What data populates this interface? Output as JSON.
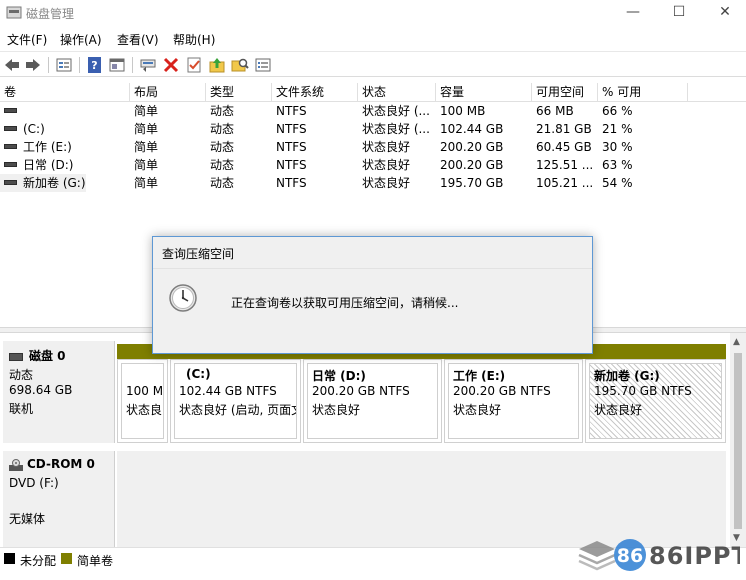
{
  "window": {
    "title": "磁盘管理",
    "controls": {
      "minimize": "—",
      "maximize": "☐",
      "close": "✕"
    }
  },
  "menu": [
    {
      "label": "文件(F)"
    },
    {
      "label": "操作(A)"
    },
    {
      "label": "查看(V)"
    },
    {
      "label": "帮助(H)"
    }
  ],
  "toolbar": {
    "icons": [
      "back-arrow-icon",
      "forward-arrow-icon",
      "disk-list-icon",
      "help-icon",
      "console-icon",
      "connect-drive-icon",
      "delete-icon",
      "properties-icon",
      "folder-up-icon",
      "folder-search-icon",
      "console-list-icon"
    ]
  },
  "volumes": {
    "columns": [
      "卷",
      "布局",
      "类型",
      "文件系统",
      "状态",
      "容量",
      "可用空间",
      "% 可用"
    ],
    "rows": [
      {
        "name": "",
        "layout": "简单",
        "type": "动态",
        "fs": "NTFS",
        "status": "状态良好 (...",
        "capacity": "100 MB",
        "free": "66 MB",
        "pct": "66 %"
      },
      {
        "name": "(C:)",
        "layout": "简单",
        "type": "动态",
        "fs": "NTFS",
        "status": "状态良好 (...",
        "capacity": "102.44 GB",
        "free": "21.81 GB",
        "pct": "21 %"
      },
      {
        "name": "工作 (E:)",
        "layout": "简单",
        "type": "动态",
        "fs": "NTFS",
        "status": "状态良好",
        "capacity": "200.20 GB",
        "free": "60.45 GB",
        "pct": "30 %"
      },
      {
        "name": "日常 (D:)",
        "layout": "简单",
        "type": "动态",
        "fs": "NTFS",
        "status": "状态良好",
        "capacity": "200.20 GB",
        "free": "125.51 ...",
        "pct": "63 %"
      },
      {
        "name": "新加卷 (G:)",
        "layout": "简单",
        "type": "动态",
        "fs": "NTFS",
        "status": "状态良好",
        "capacity": "195.70 GB",
        "free": "105.21 ...",
        "pct": "54 %"
      }
    ]
  },
  "dialog": {
    "title": "查询压缩空间",
    "message": "正在查询卷以获取可用压缩空间，请稍候..."
  },
  "disk0": {
    "name": "磁盘 0",
    "type": "动态",
    "size": "698.64 GB",
    "status": "联机",
    "partitions": [
      {
        "title": "",
        "size": "100 M",
        "status": "状态良"
      },
      {
        "title": "(C:)",
        "size": "102.44 GB NTFS",
        "status": "状态良好 (启动, 页面文"
      },
      {
        "title": "日常  (D:)",
        "size": "200.20 GB NTFS",
        "status": "状态良好"
      },
      {
        "title": "工作  (E:)",
        "size": "200.20 GB NTFS",
        "status": "状态良好"
      },
      {
        "title": "新加卷  (G:)",
        "size": "195.70 GB NTFS",
        "status": "状态良好"
      }
    ]
  },
  "cdrom0": {
    "name": "CD-ROM 0",
    "drive": "DVD (F:)",
    "media": "无媒体"
  },
  "legend": [
    {
      "label": "未分配",
      "color": "#000000"
    },
    {
      "label": "简单卷",
      "color": "#7f7f00"
    }
  ],
  "watermark": {
    "text": "86IPPT"
  },
  "colors": {
    "simple_volume": "#7f7f00",
    "dialog_border": "#5e98d4"
  }
}
